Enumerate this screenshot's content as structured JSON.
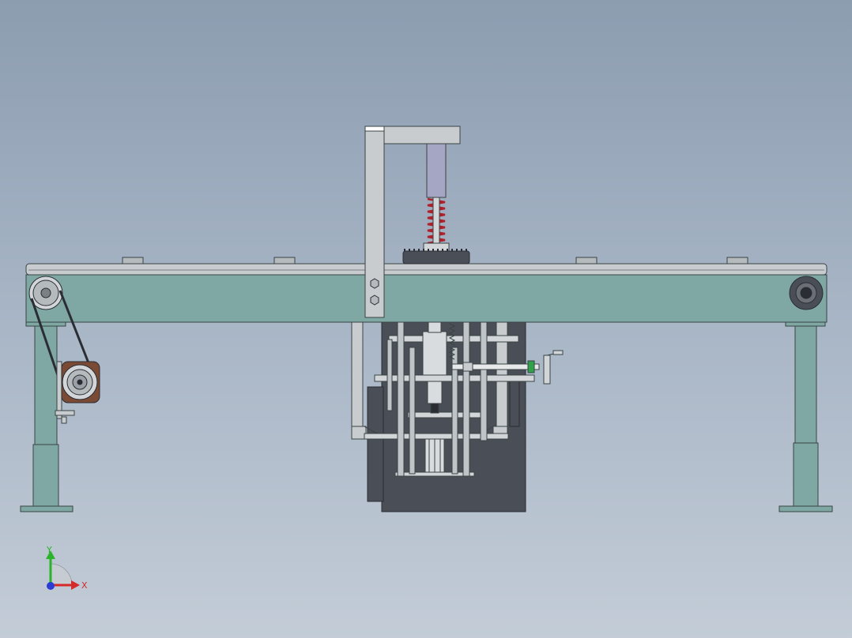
{
  "triad": {
    "x_label": "X",
    "y_label": "Y"
  },
  "colors": {
    "frame_teal": "#7fa8a4",
    "frame_stroke": "#3a4444",
    "steel": "#c8cccf",
    "dark_panel": "#4a4e56",
    "spring_red": "#b0202a",
    "motor_brown": "#7a4a35",
    "handle_green": "#2fa24a",
    "axis_x": "#d42a2a",
    "axis_y": "#2bb32b",
    "axis_z": "#2a3cd4"
  }
}
